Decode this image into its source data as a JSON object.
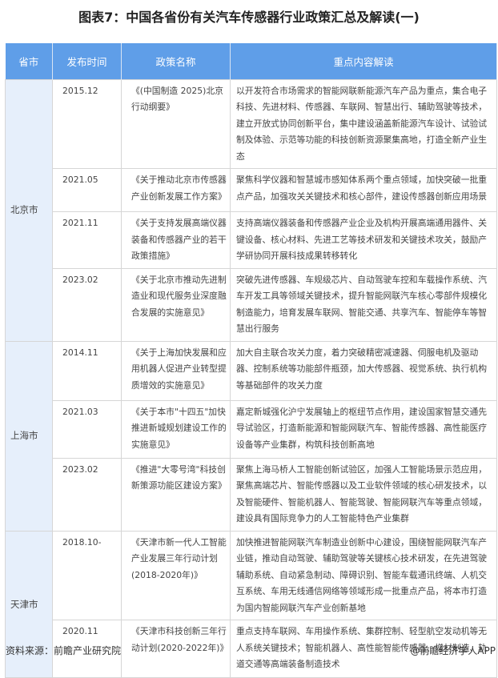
{
  "title": "图表7：中国各省份有关汽车传感器行业政策汇总及解读(一)",
  "headers": [
    "省市",
    "发布时间",
    "政策名称",
    "重点内容解读"
  ],
  "groups": [
    {
      "province": "北京市",
      "rows": [
        {
          "date": "2015.12",
          "name": "《(中国制造 2025)北京行动纲要》",
          "content": "以开发符合市场需求的智能网联新能源汽车产品为重点，集合电子科技、先进材料、传感器、车联网、智慧出行、辅助驾驶等技术，建立开放式协同创新平台，集中建设涵盖新能源汽车设计、试验试制及体验、示范等功能的科技创新资源聚集高地，打造全新产业生态"
        },
        {
          "date": "2021.05",
          "name": "《关于推动北京市传感器产业创新发展工作方案》",
          "content": "聚焦科学仪器和智慧城市感知体系两个重点领域，加快突破一批重点产品，加强攻关关键技术和核心部件，建设传感器创新应用场景"
        },
        {
          "date": "2021.11",
          "name": "《关于支持发展高端仪器装备和传感器产业的若干政策措施》",
          "content": "支持高端仪器装备和传感器产业企业及机构开展高端通用器件、关键设备、核心材料、先进工艺等技术研发和关键技术攻关，鼓励产学研协同开展科技成果转移转化"
        },
        {
          "date": "2023.02",
          "name": "《关于北京市推动先进制造业和现代服务业深度融合发展的实施意见》",
          "content": "突破先进传感器、车规级芯片、自动驾驶车控和车载操作系统、汽车开发工具等领域关键技术，提升智能网联汽车核心零部件规模化制造能力，培育发展车联网、智能交通、共享汽车、智能停车等智慧出行服务"
        }
      ]
    },
    {
      "province": "上海市",
      "rows": [
        {
          "date": "2014.11",
          "name": "《关于上海加快发展和应用机器人促进产业转型提质增效的实施意见》",
          "content": "加大自主联合攻关力度，着力突破精密减速器、伺服电机及驱动器、控制系统等功能部件瓶颈，加大传感器、视觉系统、执行机构等基础部件的攻关力度"
        },
        {
          "date": "2021.03",
          "name": "《关于本市\"十四五\"加快推进新城规划建设工作的实施意见》",
          "content": "嘉定新城强化沪宁发展轴上的枢纽节点作用，建设国家智慧交通先导试验区，打造新能源和智能网联汽车、智能传感器、高性能医疗设备等产业集群，构筑科技创新高地"
        },
        {
          "date": "2023.02",
          "name": "《推进\"大零号湾\"科技创新策源功能区建设方案》",
          "content": "聚焦上海马桥人工智能创新试验区，加强人工智能场景示范应用，聚焦高端芯片、智能传感器以及工业软件领域的核心研发技术，以及智能硬件、智能机器人、智能驾驶、智能网联汽车等重点领域，建设具有国际竞争力的人工智能特色产业集群"
        }
      ]
    },
    {
      "province": "天津市",
      "rows": [
        {
          "date": "2018.10-",
          "name": "《天津市新一代人工智能产业发展三年行动计划(2018-2020年)》",
          "content": "加快推进智能网联汽车制造业创新中心建设，围绕智能网联汽车产业链，推动自动驾驶、辅助驾驶等关键核心技术研发，在先进驾驶辅助系统、自动紧急制动、障碍识别、智能车载通讯终端、人机交互系统、车用无线通信网络等领域形成一批重点产品，将本市打造为国内智能网联汽车产业创新基地"
        },
        {
          "date": "2020.11",
          "name": "《天津市科技创新三年行动计划(2020-2022年)》",
          "content": "重点支持车联网、车用操作系统、集群控制、轻型航空发动机等无人系统关键技术；智能机器人、高性能智能传感器、增材制造、轨道交通等高端装备制造技术"
        }
      ]
    }
  ],
  "footer": {
    "source": "资料来源：前瞻产业研究院",
    "credit": "@前瞻经济学人APP"
  }
}
